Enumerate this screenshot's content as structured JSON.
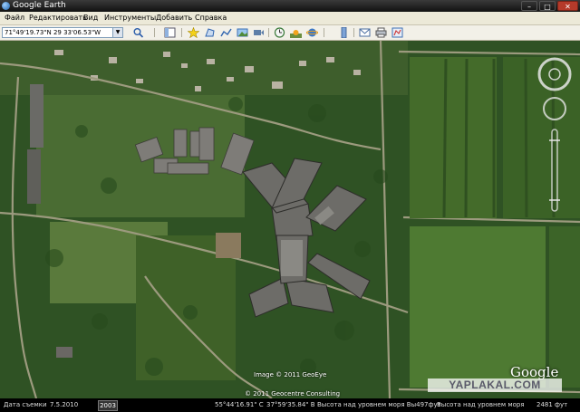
{
  "window": {
    "title": "Google Earth",
    "buttons": [
      "–",
      "□",
      "✕"
    ]
  },
  "menu": [
    "Файл",
    "Редактировать",
    "Вид",
    "Инструменты",
    "Добавить",
    "Справка"
  ],
  "toolbar": {
    "coordinates": "71°49'19.73\"N 29 33'06.53\"W",
    "icons": [
      "search-icon",
      "sidebar-icon",
      "placemark-icon",
      "polygon-icon",
      "path-icon",
      "image-overlay-icon",
      "record-tour-icon",
      "historical-imagery-icon",
      "sun-icon",
      "planets-icon",
      "ruler-icon",
      "email-icon",
      "print-icon",
      "maps-icon"
    ]
  },
  "map": {
    "imagery_credit": "Image © 2011 GeoEye",
    "data_credit": "© 2011 Geocentre Consulting",
    "logo": "Google",
    "watermark": "YAPLAKAL.COM"
  },
  "status": {
    "date_label": "Дата съемки",
    "date": "7.5.2010",
    "year": "2003",
    "lat": "55°44'16.91\" С",
    "lon": "37°59'35.84\" В",
    "terrain": "Высота над уровнем моря Вы497фут",
    "eye_alt": "Высота над уровнем моря",
    "eye_val": "2481 фут"
  },
  "colors": {
    "titlebar": "#1a1a1a",
    "menubar": "#ece9d8",
    "statusbar": "#000000",
    "field": "#3d6a2a",
    "forest": "#2f5a22"
  }
}
